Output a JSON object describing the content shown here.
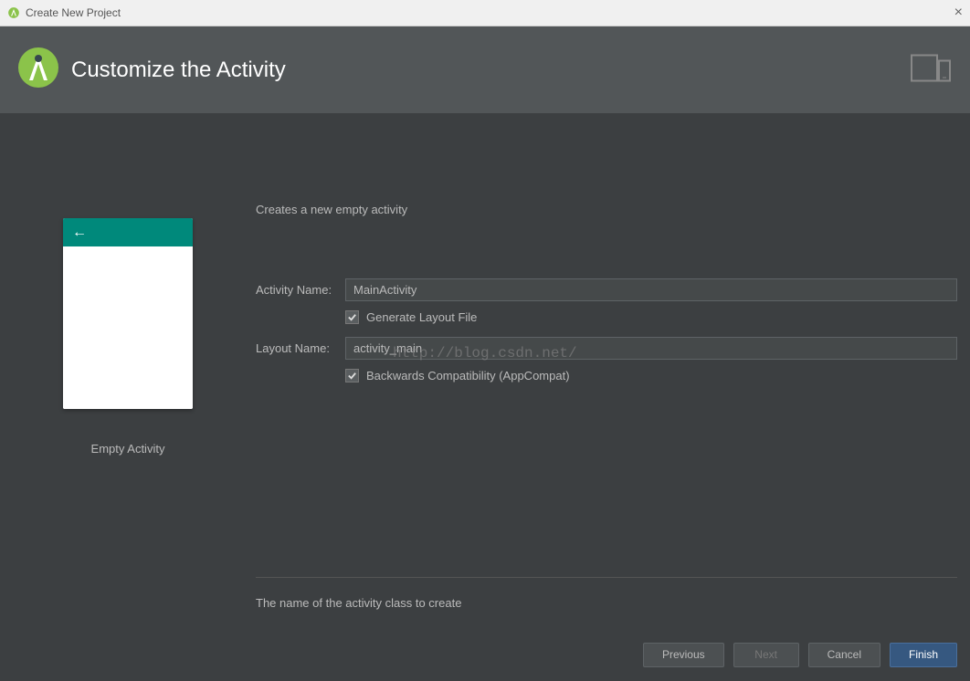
{
  "titlebar": {
    "title": "Create New Project"
  },
  "header": {
    "title": "Customize the Activity"
  },
  "preview": {
    "label": "Empty Activity"
  },
  "form": {
    "description": "Creates a new empty activity",
    "activity_name_label": "Activity Name:",
    "activity_name_value": "MainActivity",
    "generate_layout_label": "Generate Layout File",
    "generate_layout_checked": true,
    "layout_name_label": "Layout Name:",
    "layout_name_value": "activity_main",
    "backwards_compat_label": "Backwards Compatibility (AppCompat)",
    "backwards_compat_checked": true,
    "hint": "The name of the activity class to create"
  },
  "footer": {
    "previous": "Previous",
    "next": "Next",
    "cancel": "Cancel",
    "finish": "Finish"
  },
  "watermark": "http://blog.csdn.net/"
}
